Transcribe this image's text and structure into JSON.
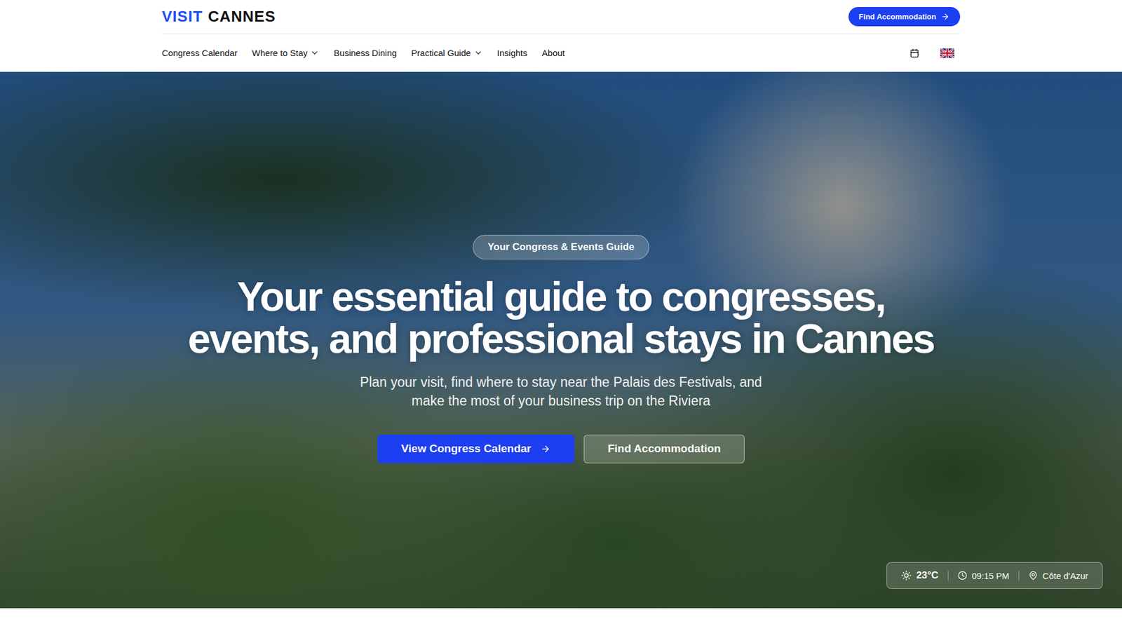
{
  "logo": {
    "accent": "VISIT",
    "name": "CANNES"
  },
  "header_button": {
    "label": "Find Accommodation"
  },
  "nav": {
    "items": [
      {
        "label": "Congress Calendar",
        "has_dropdown": false
      },
      {
        "label": "Where to Stay",
        "has_dropdown": true
      },
      {
        "label": "Business Dining",
        "has_dropdown": false
      },
      {
        "label": "Practical Guide",
        "has_dropdown": true
      },
      {
        "label": "Insights",
        "has_dropdown": false
      },
      {
        "label": "About",
        "has_dropdown": false
      }
    ]
  },
  "hero": {
    "badge": "Your Congress & Events Guide",
    "title_lines": [
      "Your essential guide to congresses,",
      "events, and professional stays in Cannes"
    ],
    "subtitle_lines": [
      "Plan your visit, find where to stay near the Palais des Festivals, and",
      "make the most of your business trip on the Riviera"
    ],
    "primary_button": "View Congress Calendar",
    "secondary_button": "Find Accommodation"
  },
  "info_bar": {
    "temperature": "23°C",
    "time": "09:15 PM",
    "location": "Côte d'Azur"
  }
}
